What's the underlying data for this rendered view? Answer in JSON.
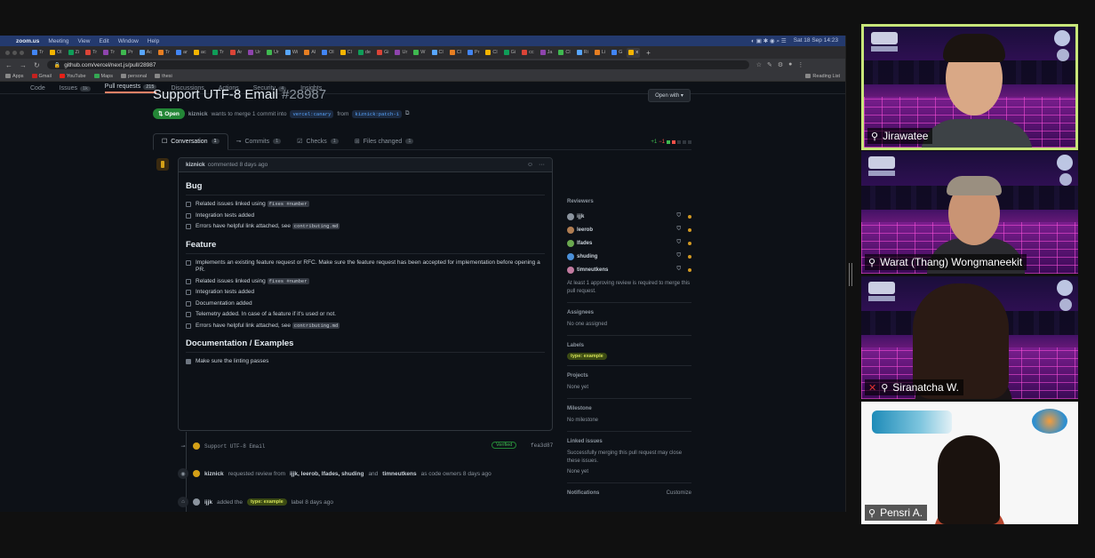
{
  "mac_menu": {
    "app": "zoom.us",
    "items": [
      "Meeting",
      "View",
      "Edit",
      "Window",
      "Help"
    ],
    "clock": "Sat 18 Sep  14:23"
  },
  "browser": {
    "url": "github.com/vercel/next.js/pull/28987",
    "tabs": [
      "Tr",
      "Ol",
      "Zi",
      "Tr",
      "Tr",
      "Pr",
      "Ac",
      "Tr",
      "ar",
      "ac",
      "Tr",
      "Ar",
      "Ur",
      "Ur",
      "Wi",
      "Al",
      "Ol",
      "Cl",
      "de",
      "Gi",
      "Ur",
      "W",
      "Cl",
      "Cl",
      "Pr",
      "Cl",
      "Gi",
      "cc",
      "Ja",
      "Cl",
      "Ri",
      "Li",
      "G",
      "x"
    ],
    "bookmarks": [
      "Apps",
      "Gmail",
      "YouTube",
      "Maps",
      "personal",
      "thesi"
    ],
    "reading_list": "Reading List"
  },
  "repo_nav": [
    {
      "label": "Code",
      "count": ""
    },
    {
      "label": "Issues",
      "count": "1k"
    },
    {
      "label": "Pull requests",
      "count": "215"
    },
    {
      "label": "Discussions",
      "count": ""
    },
    {
      "label": "Actions",
      "count": ""
    },
    {
      "label": "Security",
      "count": "4"
    },
    {
      "label": "Insights",
      "count": ""
    }
  ],
  "pr": {
    "title": "Support UTF-8 Email",
    "number": "#28987",
    "state": "Open",
    "open_with": "Open with",
    "author": "kiznick",
    "merge_text": "wants to merge 1 commit into",
    "base_branch": "vercel:canary",
    "from_text": "from",
    "head_branch": "kiznick:patch-1"
  },
  "pr_tabs": [
    {
      "label": "Conversation",
      "count": "1"
    },
    {
      "label": "Commits",
      "count": "1"
    },
    {
      "label": "Checks",
      "count": "1"
    },
    {
      "label": "Files changed",
      "count": "1"
    }
  ],
  "diffstat": {
    "additions": "+1",
    "deletions": "−1"
  },
  "comment": {
    "author": "kiznick",
    "meta": "commented 8 days ago",
    "sections": [
      {
        "heading": "Bug",
        "items": [
          {
            "text": "Related issues linked using",
            "code": "fixes #number",
            "checked": false
          },
          {
            "text": "Integration tests added",
            "code": "",
            "checked": false
          },
          {
            "text": "Errors have helpful link attached, see",
            "code": "contributing.md",
            "checked": false
          }
        ]
      },
      {
        "heading": "Feature",
        "items": [
          {
            "text": "Implements an existing feature request or RFC. Make sure the feature request has been accepted for implementation before opening a PR.",
            "code": "",
            "checked": false
          },
          {
            "text": "Related issues linked using",
            "code": "fixes #number",
            "checked": false
          },
          {
            "text": "Integration tests added",
            "code": "",
            "checked": false
          },
          {
            "text": "Documentation added",
            "code": "",
            "checked": false
          },
          {
            "text": "Telemetry added. In case of a feature if it's used or not.",
            "code": "",
            "checked": false
          },
          {
            "text": "Errors have helpful link attached, see",
            "code": "contributing.md",
            "checked": false
          }
        ]
      },
      {
        "heading": "Documentation / Examples",
        "items": [
          {
            "text": "Make sure the linting passes",
            "code": "",
            "checked": true
          }
        ]
      }
    ]
  },
  "timeline": {
    "commit_msg": "Support UTF-8 Email",
    "verified": "Verified",
    "sha": "fea3d87",
    "review_req_author": "kiznick",
    "review_req_text": "requested review from",
    "reviewers_list": "ijjk, leerob, lfades, shuding",
    "review_and": "and",
    "review_last": "timneutkens",
    "review_suffix": "as code owners 8 days ago",
    "label_author": "ijjk",
    "label_added": "added the",
    "label_name": "type: example",
    "label_suffix": "label 8 days ago"
  },
  "sidebar": {
    "reviewers_title": "Reviewers",
    "reviewers": [
      "ijjk",
      "leerob",
      "lfades",
      "shuding",
      "timneutkens"
    ],
    "review_note": "At least 1 approving review is required to merge this pull request.",
    "assignees_title": "Assignees",
    "assignees_value": "No one assigned",
    "labels_title": "Labels",
    "label": "type: example",
    "projects_title": "Projects",
    "projects_value": "None yet",
    "milestone_title": "Milestone",
    "milestone_value": "No milestone",
    "linked_title": "Linked issues",
    "linked_text": "Successfully merging this pull request may close these issues.",
    "linked_value": "None yet",
    "notifications_title": "Notifications",
    "customize": "Customize"
  },
  "participants": [
    {
      "name": "Jirawatee",
      "active": true,
      "muted": false
    },
    {
      "name": "Warat (Thang) Wongmaneekit",
      "active": false,
      "muted": false
    },
    {
      "name": "Siranatcha W.",
      "active": false,
      "muted": true
    },
    {
      "name": "Pensri A.",
      "active": false,
      "muted": false
    }
  ],
  "colors": {
    "accent": "#238636",
    "link": "#58a6ff",
    "speaker_border": "#c8e67a",
    "label_bg": "#3b4a13"
  }
}
